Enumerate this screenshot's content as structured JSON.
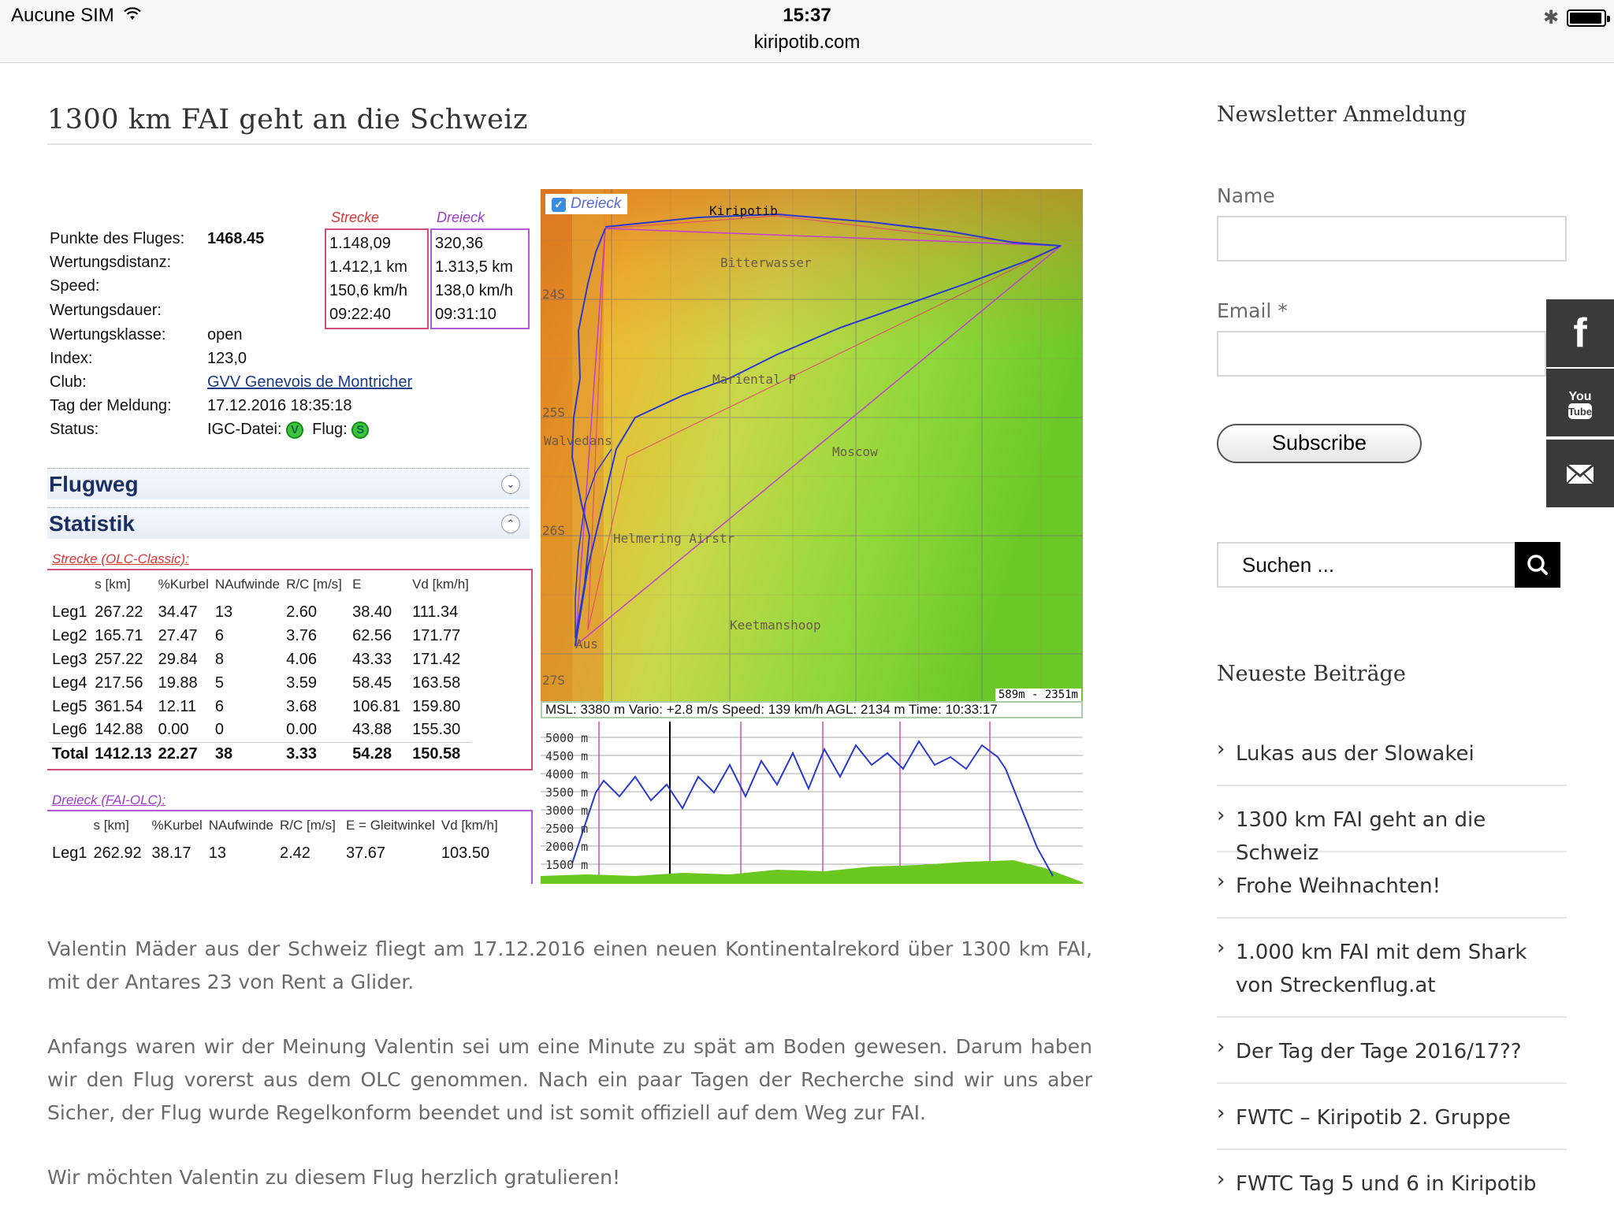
{
  "status_bar": {
    "carrier": "Aucune SIM",
    "time": "15:37",
    "url": "kiripotib.com"
  },
  "post": {
    "title": "1300 km FAI geht an die Schweiz",
    "paragraphs": [
      "Valentin Mäder aus der Schweiz  fliegt am 17.12.2016 einen neuen Kontinentalrekord über 1300 km FAI, mit der Antares 23 von Rent a Glider.",
      "Anfangs waren wir der Meinung Valentin sei um eine Minute zu spät am Boden gewesen. Darum haben wir den Flug vorerst aus dem OLC genommen. Nach ein paar Tagen der Recherche sind wir uns aber Sicher, der Flug wurde Regelkonform beendet und ist somit offiziell auf dem Weg zur FAI.",
      "Wir möchten Valentin zu diesem Flug herzlich gratulieren!"
    ]
  },
  "olc": {
    "col_strecke": "Strecke",
    "col_dreieck": "Dreieck",
    "info": [
      {
        "label": "Punkte des Fluges:",
        "value": "1468.45"
      },
      {
        "label": "Wertungsdistanz:",
        "value": ""
      },
      {
        "label": "Speed:",
        "value": ""
      },
      {
        "label": "Wertungsdauer:",
        "value": ""
      },
      {
        "label": "Wertungsklasse:",
        "value": "open"
      },
      {
        "label": "Index:",
        "value": "123,0"
      },
      {
        "label": "Club:",
        "value": "GVV Genevois de Montricher"
      },
      {
        "label": "Tag der Meldung:",
        "value": "17.12.2016 18:35:18"
      },
      {
        "label": "Status:",
        "value": ""
      }
    ],
    "strecke_box": [
      "1.148,09",
      "1.412,1 km",
      "150,6 km/h",
      "09:22:40"
    ],
    "dreieck_box": [
      "320,36",
      "1.313,5 km",
      "138,0 km/h",
      "09:31:10"
    ],
    "status_igc_label": "IGC-Datei:",
    "status_igc_badge": "V",
    "status_flug_label": "Flug:",
    "status_flug_badge": "S",
    "section_flugweg": "Flugweg",
    "section_statistik": "Statistik",
    "strecke_subhead": "Strecke (OLC-Classic):",
    "strecke_headers": [
      "",
      "s [km]",
      "%Kurbel",
      "NAufwinde",
      "R/C [m/s]",
      "E",
      "Vd [km/h]"
    ],
    "strecke_rows": [
      [
        "Leg1",
        "267.22",
        "34.47",
        "13",
        "2.60",
        "38.40",
        "111.34"
      ],
      [
        "Leg2",
        "165.71",
        "27.47",
        "6",
        "3.76",
        "62.56",
        "171.77"
      ],
      [
        "Leg3",
        "257.22",
        "29.84",
        "8",
        "4.06",
        "43.33",
        "171.42"
      ],
      [
        "Leg4",
        "217.56",
        "19.88",
        "5",
        "3.59",
        "58.45",
        "163.58"
      ],
      [
        "Leg5",
        "361.54",
        "12.11",
        "6",
        "3.68",
        "106.81",
        "159.80"
      ],
      [
        "Leg6",
        "142.88",
        "0.00",
        "0",
        "0.00",
        "43.88",
        "155.30"
      ]
    ],
    "strecke_total": [
      "Total",
      "1412.13",
      "22.27",
      "38",
      "3.33",
      "54.28",
      "150.58"
    ],
    "dreieck_subhead": "Dreieck (FAI-OLC):",
    "dreieck_headers": [
      "",
      "s [km]",
      "%Kurbel",
      "NAufwinde",
      "R/C [m/s]",
      "E = Gleitwinkel",
      "Vd [km/h]"
    ],
    "dreieck_rows": [
      [
        "Leg1",
        "262.92",
        "38.17",
        "13",
        "2.42",
        "37.67",
        "103.50"
      ]
    ]
  },
  "map": {
    "layer_label": "Dreieck",
    "places": [
      "Kiripotib",
      "Bitterwasser",
      "Mariental P",
      "Moscow",
      "Helmering Airstr",
      "Keetmanshoop",
      "Aus",
      "Walvedans"
    ],
    "lat_labels": [
      "24S",
      "25S",
      "26S",
      "27S"
    ],
    "scale": "589m - 2351m"
  },
  "baro": {
    "info": "MSL: 3380 m Vario: +2.8 m/s Speed: 139 km/h AGL: 2134 m Time: 10:33:17",
    "ticks": [
      "5000 m",
      "4500 m",
      "4000 m",
      "3500 m",
      "3000 m",
      "2500 m",
      "2000 m",
      "1500 m"
    ]
  },
  "sidebar": {
    "newsletter_title": "Newsletter Anmeldung",
    "name_label": "Name",
    "email_label": "Email *",
    "subscribe_label": "Subscribe",
    "search_placeholder": "Suchen ...",
    "recent_title": "Neueste Beiträge",
    "recent": [
      "Lukas aus der Slowakei",
      "1300 km FAI geht an die Schweiz",
      "Frohe Weihnachten!",
      "1.000 km FAI mit dem Shark von Streckenflug.at",
      "Der Tag der Tage 2016/17??",
      "FWTC – Kiripotib 2. Gruppe",
      "FWTC Tag 5 und 6 in Kiripotib"
    ]
  },
  "social": [
    "facebook-icon",
    "youtube-icon",
    "mail-icon"
  ],
  "colors": {
    "accent_dark": "#3a3a3a",
    "strecke": "#d33333",
    "dreieck": "#9a3ccc",
    "track": "#2a3ad0"
  }
}
